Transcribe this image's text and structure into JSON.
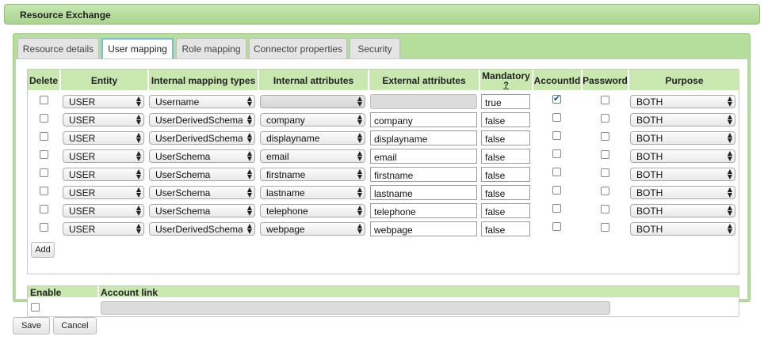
{
  "window": {
    "title": "Resource Exchange"
  },
  "tabs": [
    {
      "label": "Resource details",
      "active": false
    },
    {
      "label": "User mapping",
      "active": true
    },
    {
      "label": "Role mapping",
      "active": false
    },
    {
      "label": "Connector properties",
      "active": false
    },
    {
      "label": "Security",
      "active": false
    }
  ],
  "table": {
    "headers": {
      "delete": "Delete",
      "entity": "Entity",
      "internal_mapping_types": "Internal mapping types",
      "internal_attributes": "Internal attributes",
      "external_attributes": "External attributes",
      "mandatory": "Mandatory",
      "mandatory_help": "?",
      "account_id": "AccountId",
      "password": "Password",
      "purpose": "Purpose"
    },
    "rows": [
      {
        "delete": false,
        "entity": "USER",
        "mapping_type": "Username",
        "internal_attribute": "",
        "external_attribute": "",
        "mandatory": "true",
        "account_id": true,
        "password": false,
        "purpose": "BOTH"
      },
      {
        "delete": false,
        "entity": "USER",
        "mapping_type": "UserDerivedSchema",
        "internal_attribute": "company",
        "external_attribute": "company",
        "mandatory": "false",
        "account_id": false,
        "password": false,
        "purpose": "BOTH"
      },
      {
        "delete": false,
        "entity": "USER",
        "mapping_type": "UserDerivedSchema",
        "internal_attribute": "displayname",
        "external_attribute": "displayname",
        "mandatory": "false",
        "account_id": false,
        "password": false,
        "purpose": "BOTH"
      },
      {
        "delete": false,
        "entity": "USER",
        "mapping_type": "UserSchema",
        "internal_attribute": "email",
        "external_attribute": "email",
        "mandatory": "false",
        "account_id": false,
        "password": false,
        "purpose": "BOTH"
      },
      {
        "delete": false,
        "entity": "USER",
        "mapping_type": "UserSchema",
        "internal_attribute": "firstname",
        "external_attribute": "firstname",
        "mandatory": "false",
        "account_id": false,
        "password": false,
        "purpose": "BOTH"
      },
      {
        "delete": false,
        "entity": "USER",
        "mapping_type": "UserSchema",
        "internal_attribute": "lastname",
        "external_attribute": "lastname",
        "mandatory": "false",
        "account_id": false,
        "password": false,
        "purpose": "BOTH"
      },
      {
        "delete": false,
        "entity": "USER",
        "mapping_type": "UserSchema",
        "internal_attribute": "telephone",
        "external_attribute": "telephone",
        "mandatory": "false",
        "account_id": false,
        "password": false,
        "purpose": "BOTH"
      },
      {
        "delete": false,
        "entity": "USER",
        "mapping_type": "UserDerivedSchema",
        "internal_attribute": "webpage",
        "external_attribute": "webpage",
        "mandatory": "false",
        "account_id": false,
        "password": false,
        "purpose": "BOTH"
      }
    ],
    "add_label": "Add"
  },
  "account_link": {
    "enable_header": "Enable",
    "link_header": "Account link",
    "enabled": false,
    "value": ""
  },
  "footer": {
    "save_label": "Save",
    "cancel_label": "Cancel"
  },
  "icons": {
    "select_arrow": "up-down-arrows-icon",
    "check": "checkmark-icon"
  },
  "colors": {
    "title_bar": "#b3dd99",
    "header_bg": "#c8e8b0",
    "panel_bg": "#b5dd9b",
    "active_tab_border": "#7fb7d6"
  }
}
